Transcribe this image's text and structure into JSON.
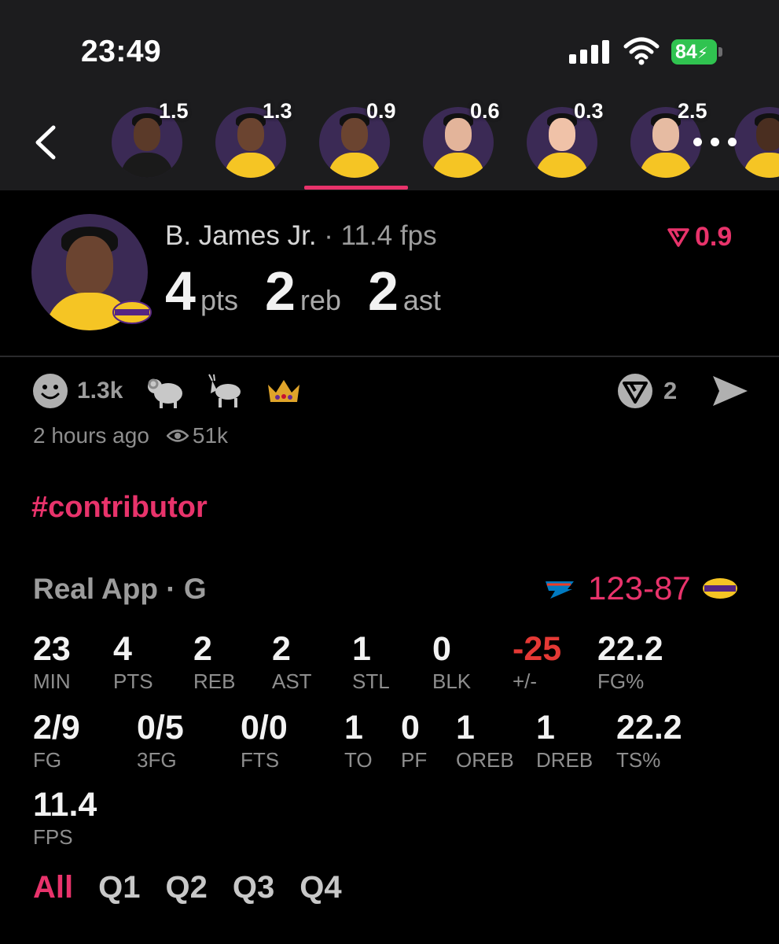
{
  "status_bar": {
    "time": "23:49",
    "battery": "84"
  },
  "header": {
    "players": [
      {
        "value": "1.5",
        "skin": "#5b3a29",
        "jersey": "#1a1a1a"
      },
      {
        "value": "1.3",
        "skin": "#6b4430",
        "jersey": "#f5c524"
      },
      {
        "value": "0.9",
        "skin": "#6b4430",
        "jersey": "#f5c524"
      },
      {
        "value": "0.6",
        "skin": "#e3b49a",
        "jersey": "#f5c524"
      },
      {
        "value": "0.3",
        "skin": "#f0c2a8",
        "jersey": "#f5c524"
      },
      {
        "value": "2.5",
        "skin": "#e6bba2",
        "jersey": "#f5c524"
      },
      {
        "value": "",
        "skin": "#4a2e20",
        "jersey": "#f5c524"
      }
    ]
  },
  "player": {
    "name": "B. James Jr.",
    "fps_label": "· 11.4 fps",
    "pts": "4",
    "pts_label": "pts",
    "reb": "2",
    "reb_label": "reb",
    "ast": "2",
    "ast_label": "ast",
    "vote_value": "0.9"
  },
  "reactions": {
    "count": "1.3k",
    "shares": "2"
  },
  "meta": {
    "time_ago": "2 hours ago",
    "views": "51k"
  },
  "hashtag": "#contributor",
  "game": {
    "title": "Real App · G",
    "score_home": "123",
    "score_sep": "-",
    "score_away": "87",
    "stats_row1": [
      {
        "v": "23",
        "l": "MIN"
      },
      {
        "v": "4",
        "l": "PTS"
      },
      {
        "v": "2",
        "l": "REB"
      },
      {
        "v": "2",
        "l": "AST"
      },
      {
        "v": "1",
        "l": "STL"
      },
      {
        "v": "0",
        "l": "BLK"
      },
      {
        "v": "-25",
        "l": "+/-"
      },
      {
        "v": "22.2",
        "l": "FG%"
      }
    ],
    "stats_row2": [
      {
        "v": "2/9",
        "l": "FG"
      },
      {
        "v": "0/5",
        "l": "3FG"
      },
      {
        "v": "0/0",
        "l": "FTS"
      },
      {
        "v": "1",
        "l": "TO"
      },
      {
        "v": "0",
        "l": "PF"
      },
      {
        "v": "1",
        "l": "OREB"
      },
      {
        "v": "1",
        "l": "DREB"
      },
      {
        "v": "22.2",
        "l": "TS%"
      }
    ],
    "stats_row3": [
      {
        "v": "11.4",
        "l": "FPS"
      }
    ]
  },
  "filters": [
    "All",
    "Q1",
    "Q2",
    "Q3",
    "Q4"
  ],
  "colors": {
    "accent": "#e8336b",
    "negative": "#e53935",
    "battery": "#30c350"
  }
}
